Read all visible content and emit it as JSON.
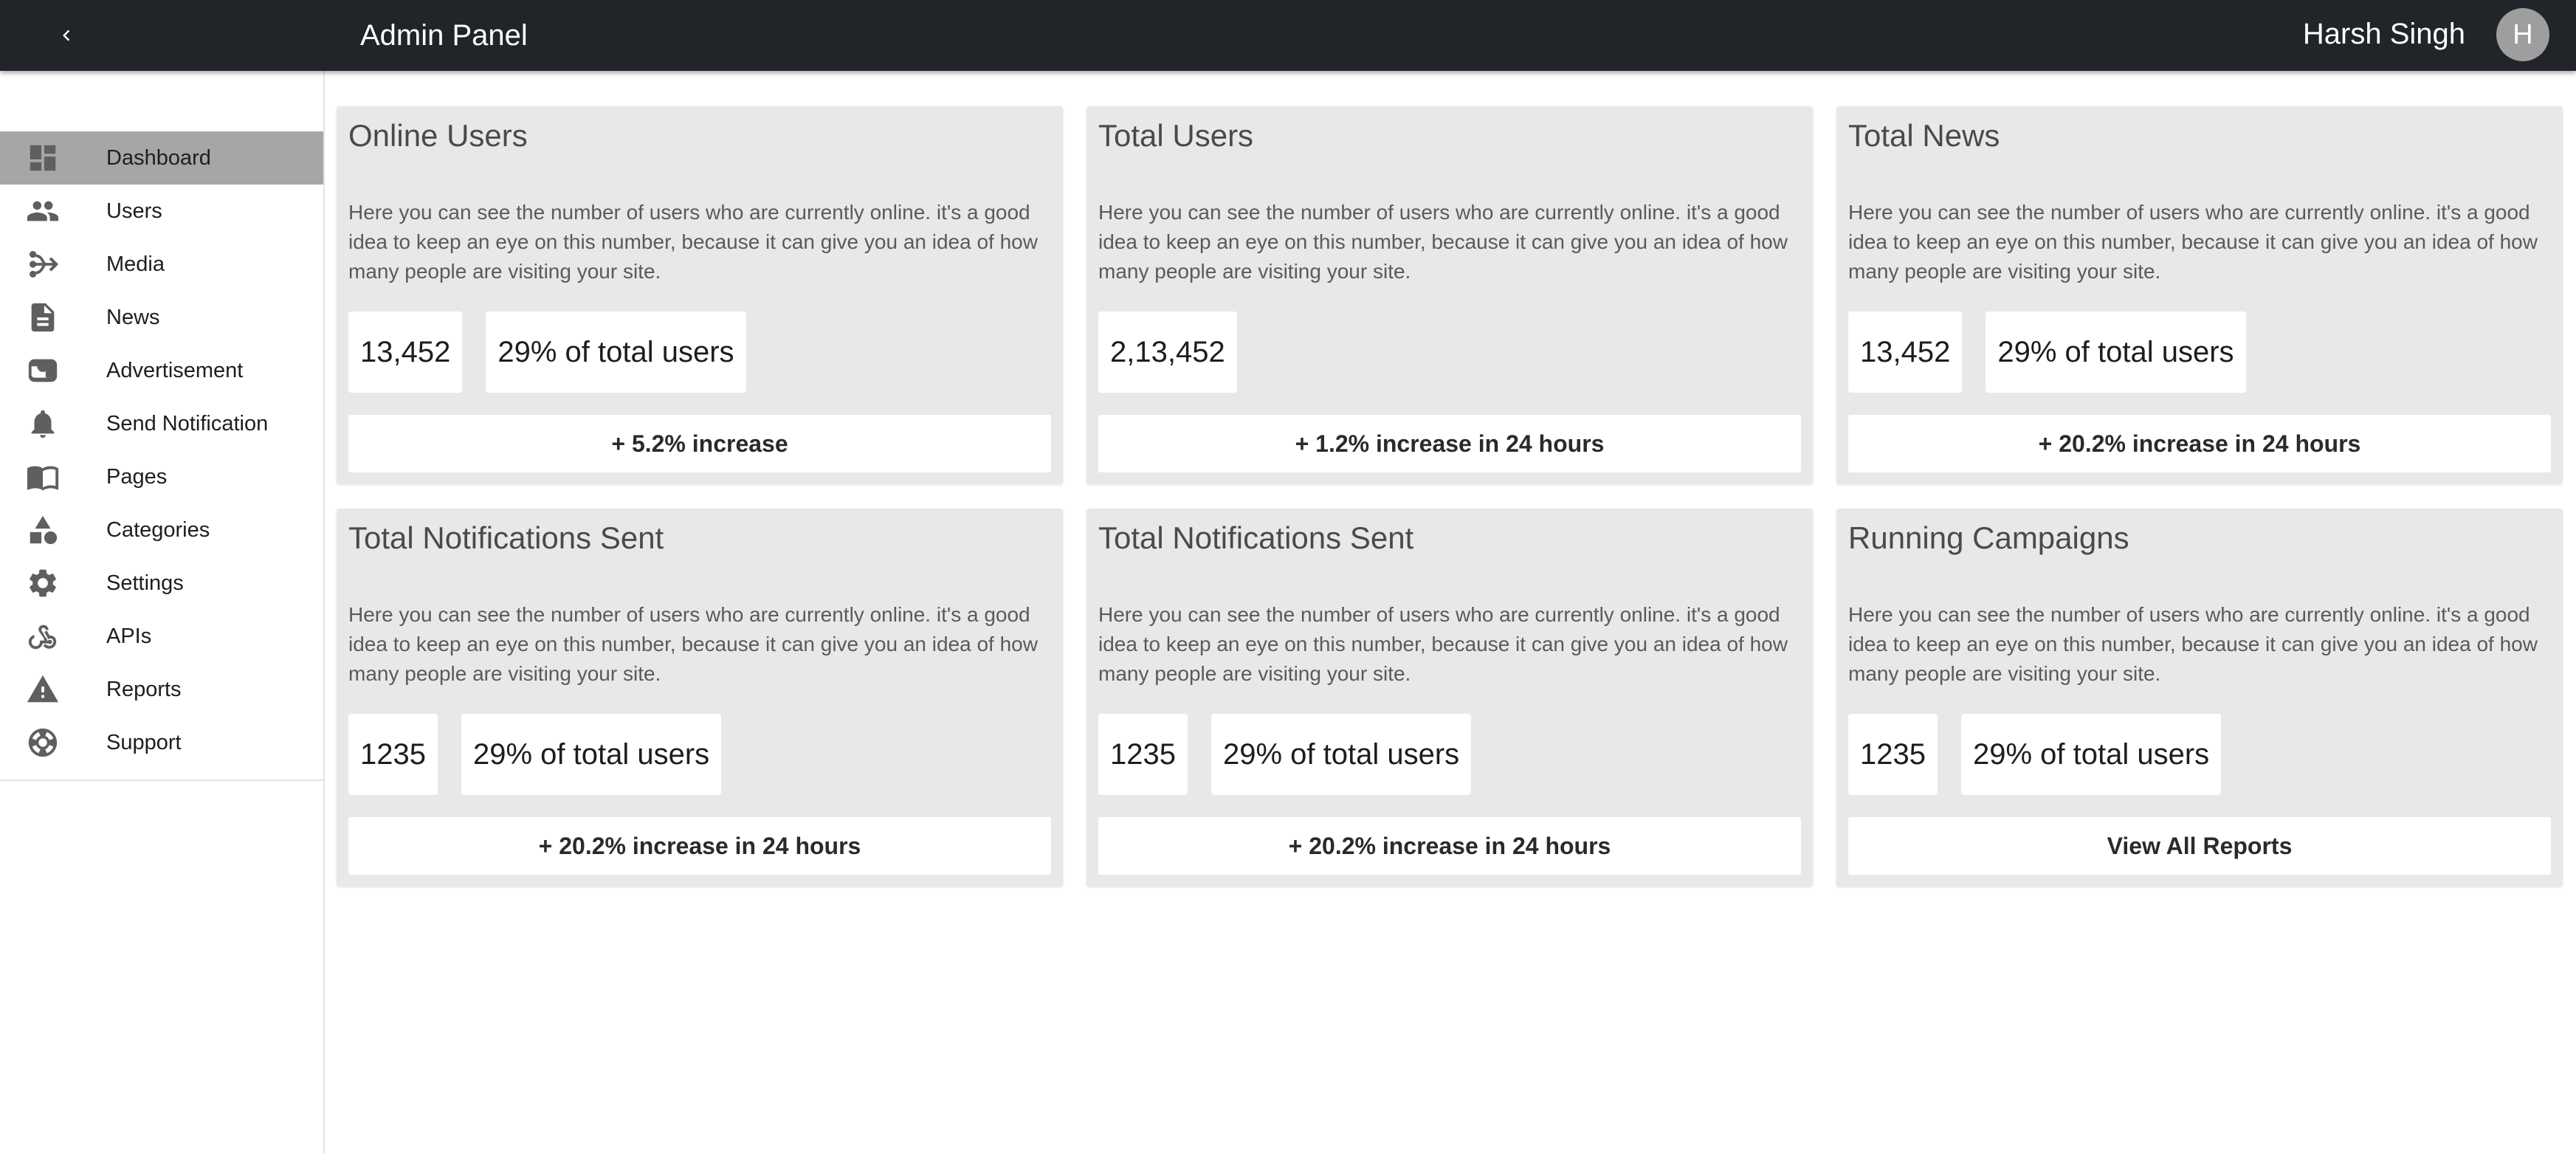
{
  "header": {
    "title": "Admin Panel",
    "user_name": "Harsh Singh",
    "avatar_initial": "H"
  },
  "sidebar": {
    "items": [
      {
        "label": "Dashboard",
        "icon": "dashboard-icon",
        "active": true
      },
      {
        "label": "Users",
        "icon": "users-icon"
      },
      {
        "label": "Media",
        "icon": "media-icon"
      },
      {
        "label": "News",
        "icon": "news-icon"
      },
      {
        "label": "Advertisement",
        "icon": "advertisement-icon"
      },
      {
        "label": "Send Notification",
        "icon": "bell-icon"
      },
      {
        "label": "Pages",
        "icon": "pages-icon"
      },
      {
        "label": "Categories",
        "icon": "categories-icon"
      },
      {
        "label": "Settings",
        "icon": "gear-icon"
      },
      {
        "label": "APIs",
        "icon": "webhook-icon"
      },
      {
        "label": "Reports",
        "icon": "warning-icon"
      },
      {
        "label": "Support",
        "icon": "support-icon"
      }
    ]
  },
  "cards": [
    {
      "title": "Online Users",
      "description": "Here you can see the number of users who are currently online. it's a good idea to keep an eye on this number, because it can give you an idea of how many people are visiting your site.",
      "value": "13,452",
      "share": "29% of total users",
      "footer": "+ 5.2% increase"
    },
    {
      "title": "Total Users",
      "description": "Here you can see the number of users who are currently online. it's a good idea to keep an eye on this number, because it can give you an idea of how many people are visiting your site.",
      "value": "2,13,452",
      "footer": "+ 1.2% increase in 24 hours"
    },
    {
      "title": "Total News",
      "description": "Here you can see the number of users who are currently online. it's a good idea to keep an eye on this number, because it can give you an idea of how many people are visiting your site.",
      "value": "13,452",
      "share": "29% of total users",
      "footer": "+ 20.2% increase in 24 hours"
    },
    {
      "title": "Total Notifications Sent",
      "description": "Here you can see the number of users who are currently online. it's a good idea to keep an eye on this number, because it can give you an idea of how many people are visiting your site.",
      "value": "1235",
      "share": "29% of total users",
      "footer": "+ 20.2% increase in 24 hours"
    },
    {
      "title": "Total Notifications Sent",
      "description": "Here you can see the number of users who are currently online. it's a good idea to keep an eye on this number, because it can give you an idea of how many people are visiting your site.",
      "value": "1235",
      "share": "29% of total users",
      "footer": "+ 20.2% increase in 24 hours"
    },
    {
      "title": "Running Campaigns",
      "description": "Here you can see the number of users who are currently online. it's a good idea to keep an eye on this number, because it can give you an idea of how many people are visiting your site.",
      "value": "1235",
      "share": "29% of total users",
      "footer": "View All Reports"
    }
  ]
}
